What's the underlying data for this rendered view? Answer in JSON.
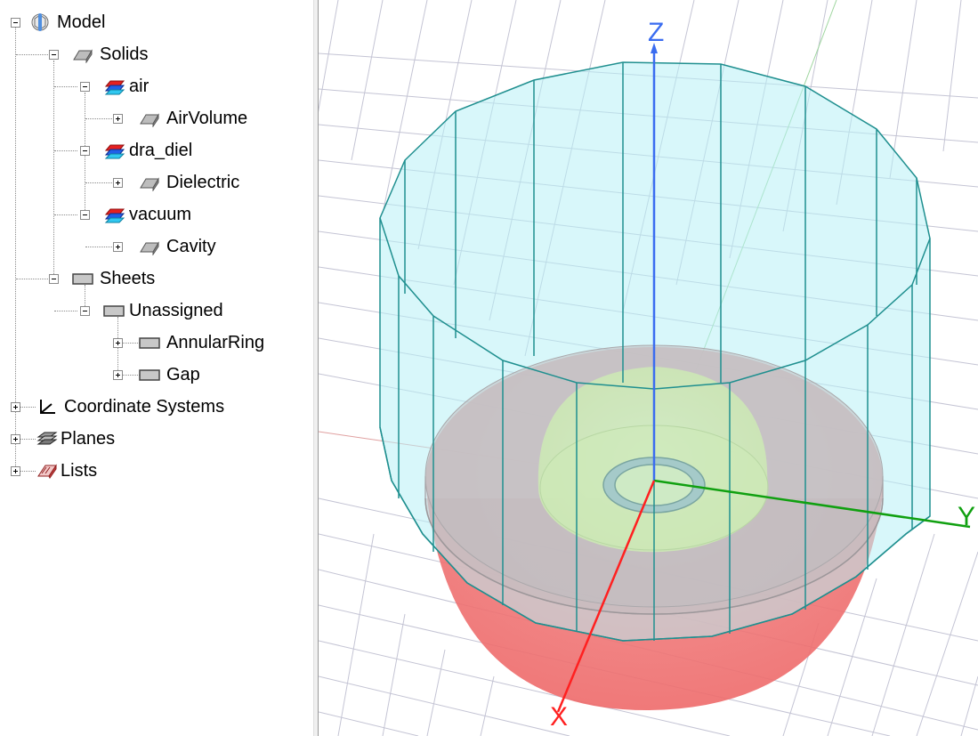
{
  "tree": {
    "model": "Model",
    "solids": "Solids",
    "air": "air",
    "air_volume": "AirVolume",
    "dra_diel": "dra_diel",
    "dielectric": "Dielectric",
    "vacuum": "vacuum",
    "cavity": "Cavity",
    "sheets": "Sheets",
    "unassigned": "Unassigned",
    "annular_ring": "AnnularRing",
    "gap": "Gap",
    "coordinate_systems": "Coordinate Systems",
    "planes": "Planes",
    "lists": "Lists"
  },
  "viewport": {
    "axis_x": "X",
    "axis_y": "Y",
    "axis_z": "Z"
  },
  "colors": {
    "axis_x": "#ff2020",
    "axis_y": "#10a010",
    "axis_z": "#3a6cf0",
    "air_volume": "#c6f4f8",
    "edges": "#1f8f8f",
    "dielectric": "#eeee70",
    "cavity": "#ee8080",
    "grid": "#c4c4d4"
  }
}
